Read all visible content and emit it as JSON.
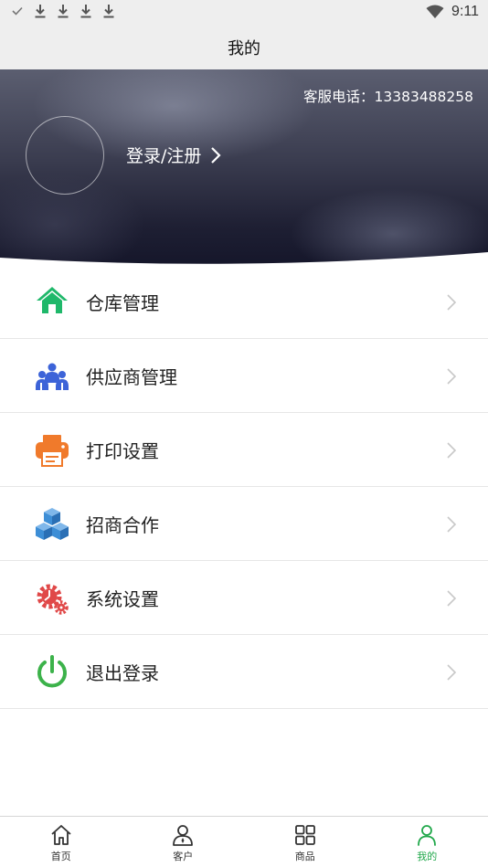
{
  "status_bar": {
    "time": "9:11",
    "left_icons": [
      "check-icon",
      "download-icon",
      "download-icon",
      "download-icon",
      "download-icon"
    ],
    "right_icons": [
      "wifi-icon"
    ]
  },
  "header": {
    "title": "我的"
  },
  "profile": {
    "hotline": "客服电话：13383488258",
    "login_text": "登录/注册"
  },
  "menu": [
    {
      "label": "仓库管理",
      "icon": "warehouse-icon",
      "color": "#1fb86a"
    },
    {
      "label": "供应商管理",
      "icon": "suppliers-icon",
      "color": "#3c63d8"
    },
    {
      "label": "打印设置",
      "icon": "printer-icon",
      "color": "#f07a2b"
    },
    {
      "label": "招商合作",
      "icon": "cubes-icon",
      "color": "#3d8ed6"
    },
    {
      "label": "系统设置",
      "icon": "settings-gears-icon",
      "color": "#e04848"
    },
    {
      "label": "退出登录",
      "icon": "power-icon",
      "color": "#3cb24a"
    }
  ],
  "tabbar": {
    "active_color": "#21a84b",
    "tabs": [
      {
        "label": "首页",
        "icon": "home-icon",
        "active": false
      },
      {
        "label": "客户",
        "icon": "customer-icon",
        "active": false
      },
      {
        "label": "商品",
        "icon": "grid-icon",
        "active": false
      },
      {
        "label": "我的",
        "icon": "person-icon",
        "active": true
      }
    ]
  }
}
